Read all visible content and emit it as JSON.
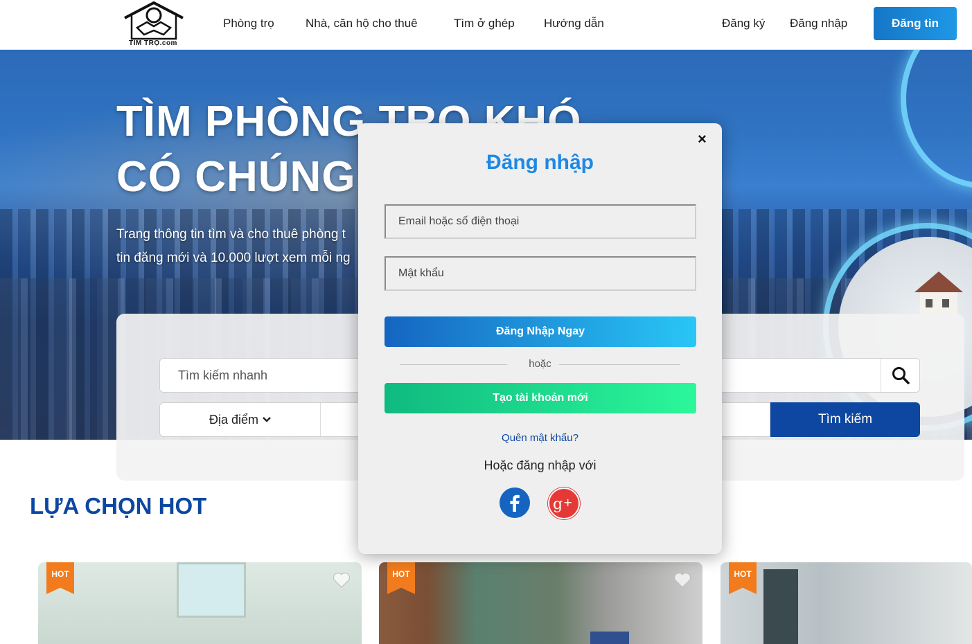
{
  "header": {
    "logo_text": "TÌM TRỌ.com",
    "nav": [
      "Phòng trọ",
      "Nhà, căn hộ cho thuê",
      "Tìm ở ghép",
      "Hướng dẫn"
    ],
    "register": "Đăng ký",
    "login": "Đăng nhập",
    "post_button": "Đăng tin"
  },
  "hero": {
    "title_line1": "TÌM PHÒNG TRỌ KHÓ",
    "title_line2": "CÓ CHÚNG",
    "subtitle_line1": "Trang thông tin tìm và cho thuê phòng t",
    "subtitle_line2": "tin đăng mới và 10.000 lượt xem mỗi ng"
  },
  "search": {
    "placeholder": "Tìm kiếm nhanh",
    "location_label": "Địa điểm",
    "search_button": "Tìm kiếm"
  },
  "section": {
    "title": "LỰA CHỌN HOT"
  },
  "cards": [
    {
      "badge": "HOT"
    },
    {
      "badge": "HOT"
    },
    {
      "badge": "HOT"
    }
  ],
  "modal": {
    "title": "Đăng nhập",
    "email_placeholder": "Email hoặc số điện thoại",
    "password_placeholder": "Mật khẩu",
    "login_button": "Đăng Nhập Ngay",
    "or_text": "hoặc",
    "create_button": "Tạo tài khoản mới",
    "forgot_link": "Quên mật khẩu?",
    "social_text": "Hoặc đăng nhập với",
    "close_symbol": "×"
  },
  "colors": {
    "brand_blue": "#0d47a1",
    "accent_blue": "#1e88e5",
    "hot_orange": "#f27c1d",
    "green": "#2cf79a",
    "facebook": "#1565c0",
    "google": "#e53935"
  },
  "icons": [
    "logo-icon",
    "search-icon",
    "chevron-down-icon",
    "close-icon",
    "heart-icon",
    "facebook-icon",
    "google-plus-icon"
  ]
}
